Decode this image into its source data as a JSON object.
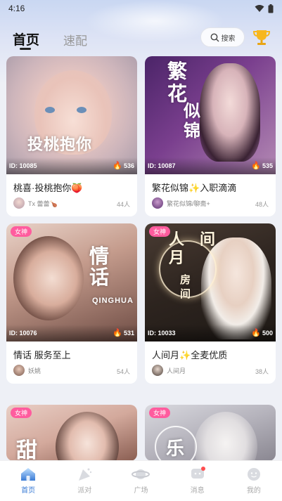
{
  "status_bar": {
    "time": "4:16"
  },
  "header": {
    "tab_home": "首页",
    "tab_match": "速配",
    "search_label": "搜索"
  },
  "cards": [
    {
      "id_label": "ID: 10085",
      "heat": "536",
      "title": "桃喜·投桃抱你",
      "emoji": "🍑",
      "owner": "Tx 蕾蕾🍗",
      "count": "44人",
      "badge": "",
      "overlay": "投桃抱你"
    },
    {
      "id_label": "ID: 10087",
      "heat": "535",
      "title": "繁花似锦",
      "title_suffix": "入职滴滴",
      "owner": "繁花似锦/聊斋+",
      "count": "48人",
      "badge": "",
      "overlay": "繁花似锦"
    },
    {
      "id_label": "ID: 10076",
      "heat": "531",
      "title": "情话 服务至上",
      "owner": "妖姚",
      "count": "54人",
      "badge": "女神",
      "overlay": "情话"
    },
    {
      "id_label": "ID: 10033",
      "heat": "500",
      "title": "人间月",
      "title_suffix": "全麦优质",
      "owner": "人间月",
      "count": "38人",
      "badge": "女神",
      "overlay": "人间房间"
    },
    {
      "badge": "女神",
      "overlay": "甜"
    },
    {
      "badge": "女神",
      "overlay": "乐"
    }
  ],
  "nav": [
    {
      "label": "首页",
      "icon": "home-icon",
      "active": true
    },
    {
      "label": "派对",
      "icon": "party-icon",
      "active": false
    },
    {
      "label": "广场",
      "icon": "planet-icon",
      "active": false
    },
    {
      "label": "消息",
      "icon": "message-icon",
      "active": false
    },
    {
      "label": "我的",
      "icon": "profile-icon",
      "active": false
    }
  ],
  "colors": {
    "accent": "#3a7bd5",
    "badge": "#ff5c9e",
    "heat": "#ff6a1a"
  }
}
